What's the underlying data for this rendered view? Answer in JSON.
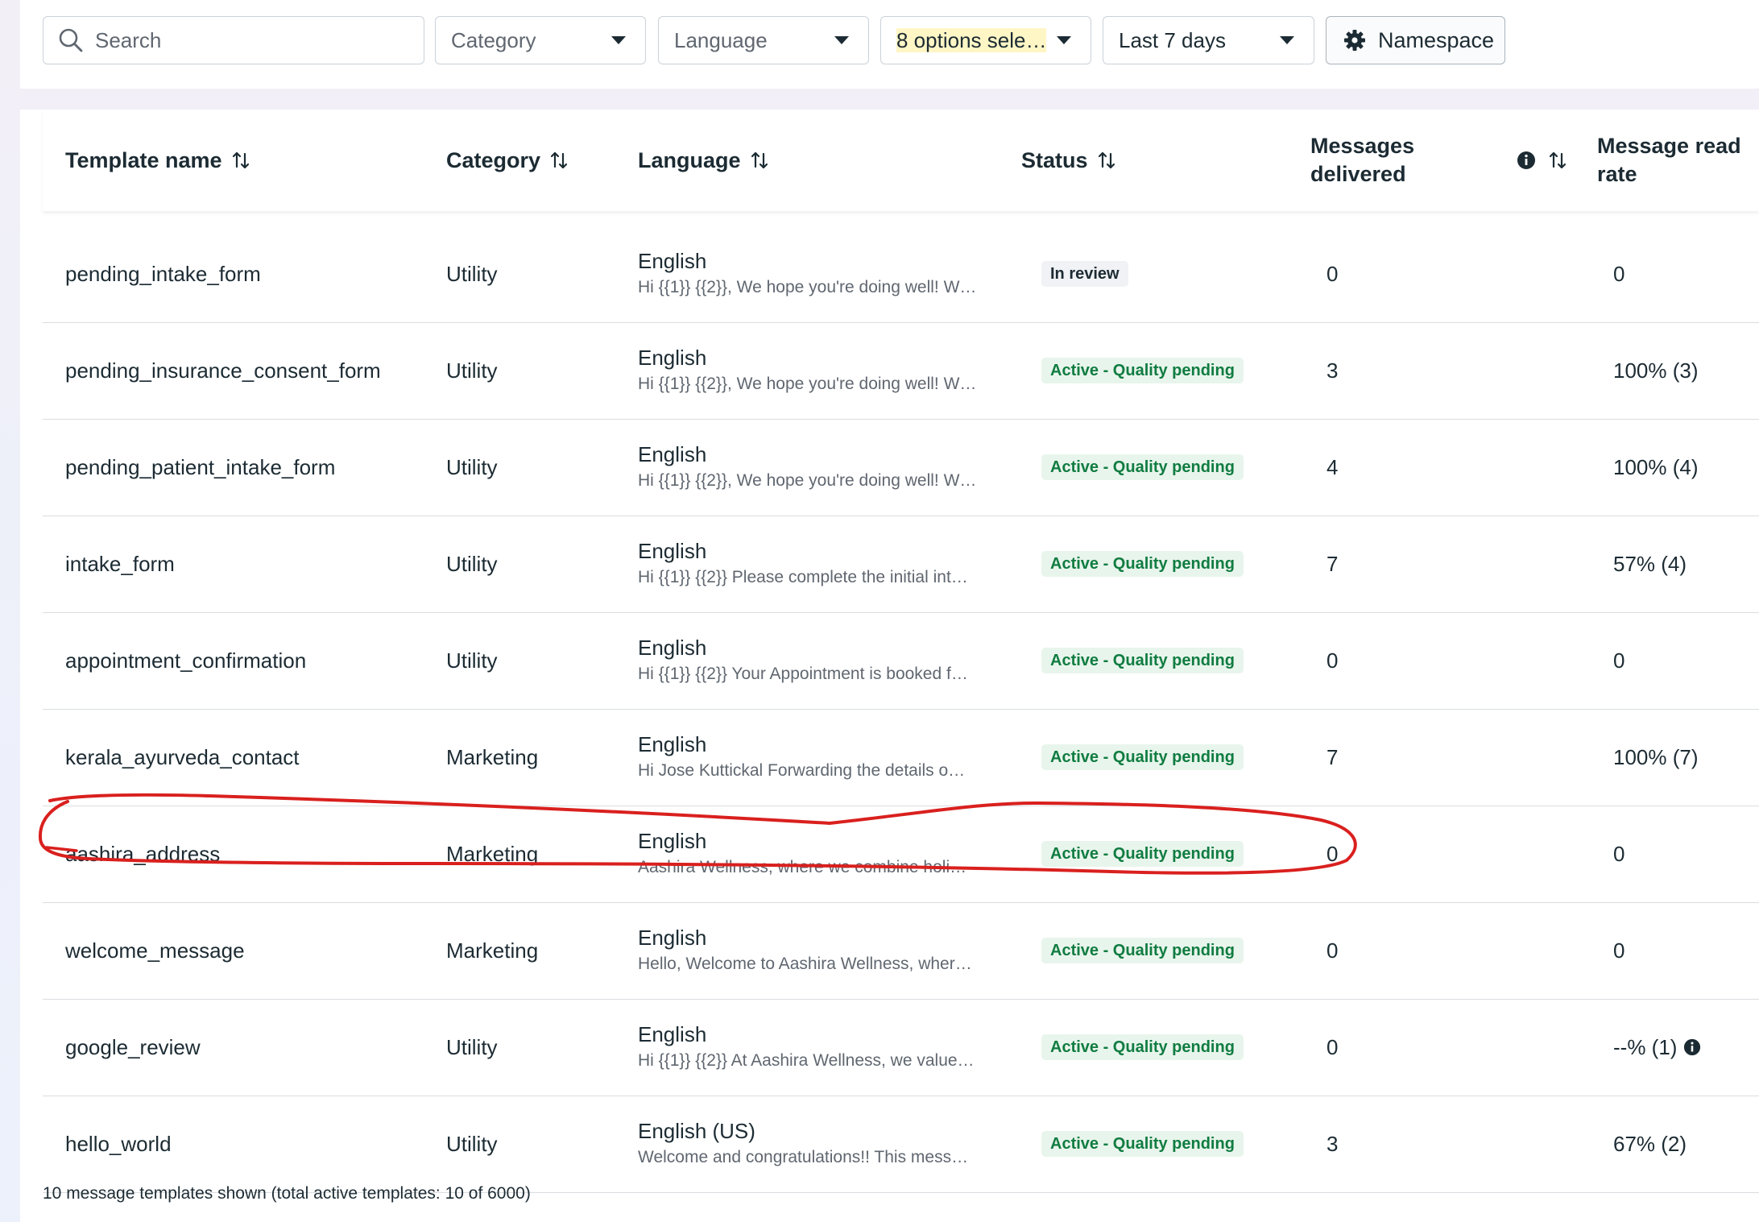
{
  "filters": {
    "search_placeholder": "Search",
    "category_label": "Category",
    "language_label": "Language",
    "status_label": "8 options sele…",
    "date_label": "Last 7 days",
    "namespace_label": "Namespace"
  },
  "table": {
    "headers": {
      "name": "Template name",
      "category": "Category",
      "language": "Language",
      "status": "Status",
      "delivered_line1": "Messages",
      "delivered_line2": "delivered",
      "read_line1": "Message read",
      "read_line2": "rate"
    },
    "rows": [
      {
        "name": "pending_intake_form",
        "category": "Utility",
        "language": "English",
        "preview": "Hi {{1}} {{2}}, We hope you're doing well! W…",
        "status": "In review",
        "status_type": "review",
        "delivered": "0",
        "read_rate": "0"
      },
      {
        "name": "pending_insurance_consent_form",
        "category": "Utility",
        "language": "English",
        "preview": "Hi {{1}} {{2}}, We hope you're doing well! W…",
        "status": "Active - Quality pending",
        "status_type": "active",
        "delivered": "3",
        "read_rate": "100% (3)"
      },
      {
        "name": "pending_patient_intake_form",
        "category": "Utility",
        "language": "English",
        "preview": "Hi {{1}} {{2}}, We hope you're doing well! W…",
        "status": "Active - Quality pending",
        "status_type": "active",
        "delivered": "4",
        "read_rate": "100% (4)"
      },
      {
        "name": "intake_form",
        "category": "Utility",
        "language": "English",
        "preview": "Hi {{1}} {{2}} Please complete the initial int…",
        "status": "Active - Quality pending",
        "status_type": "active",
        "delivered": "7",
        "read_rate": "57% (4)"
      },
      {
        "name": "appointment_confirmation",
        "category": "Utility",
        "language": "English",
        "preview": "Hi {{1}} {{2}} Your Appointment is booked f…",
        "status": "Active - Quality pending",
        "status_type": "active",
        "delivered": "0",
        "read_rate": "0"
      },
      {
        "name": "kerala_ayurveda_contact",
        "category": "Marketing",
        "language": "English",
        "preview": "Hi Jose Kuttickal Forwarding the details o…",
        "status": "Active - Quality pending",
        "status_type": "active",
        "delivered": "7",
        "read_rate": "100% (7)"
      },
      {
        "name": "aashira_address",
        "category": "Marketing",
        "language": "English",
        "preview": "Aashira Wellness, where we combine holi…",
        "status": "Active - Quality pending",
        "status_type": "active",
        "delivered": "0",
        "read_rate": "0"
      },
      {
        "name": "welcome_message",
        "category": "Marketing",
        "language": "English",
        "preview": "Hello, Welcome to Aashira Wellness, wher…",
        "status": "Active - Quality pending",
        "status_type": "active",
        "delivered": "0",
        "read_rate": "0"
      },
      {
        "name": "google_review",
        "category": "Utility",
        "language": "English",
        "preview": "Hi {{1}} {{2}} At Aashira Wellness, we value…",
        "status": "Active - Quality pending",
        "status_type": "active",
        "delivered": "0",
        "read_rate": "--% (1)",
        "read_info": true
      },
      {
        "name": "hello_world",
        "category": "Utility",
        "language": "English (US)",
        "preview": "Welcome and congratulations!! This mess…",
        "status": "Active - Quality pending",
        "status_type": "active",
        "delivered": "3",
        "read_rate": "67% (2)"
      }
    ]
  },
  "footer": {
    "summary": "10 message templates shown (total active templates: 10 of 6000)"
  },
  "annotation": {
    "color": "#d9201e",
    "highlighted_row": "aashira_address"
  }
}
